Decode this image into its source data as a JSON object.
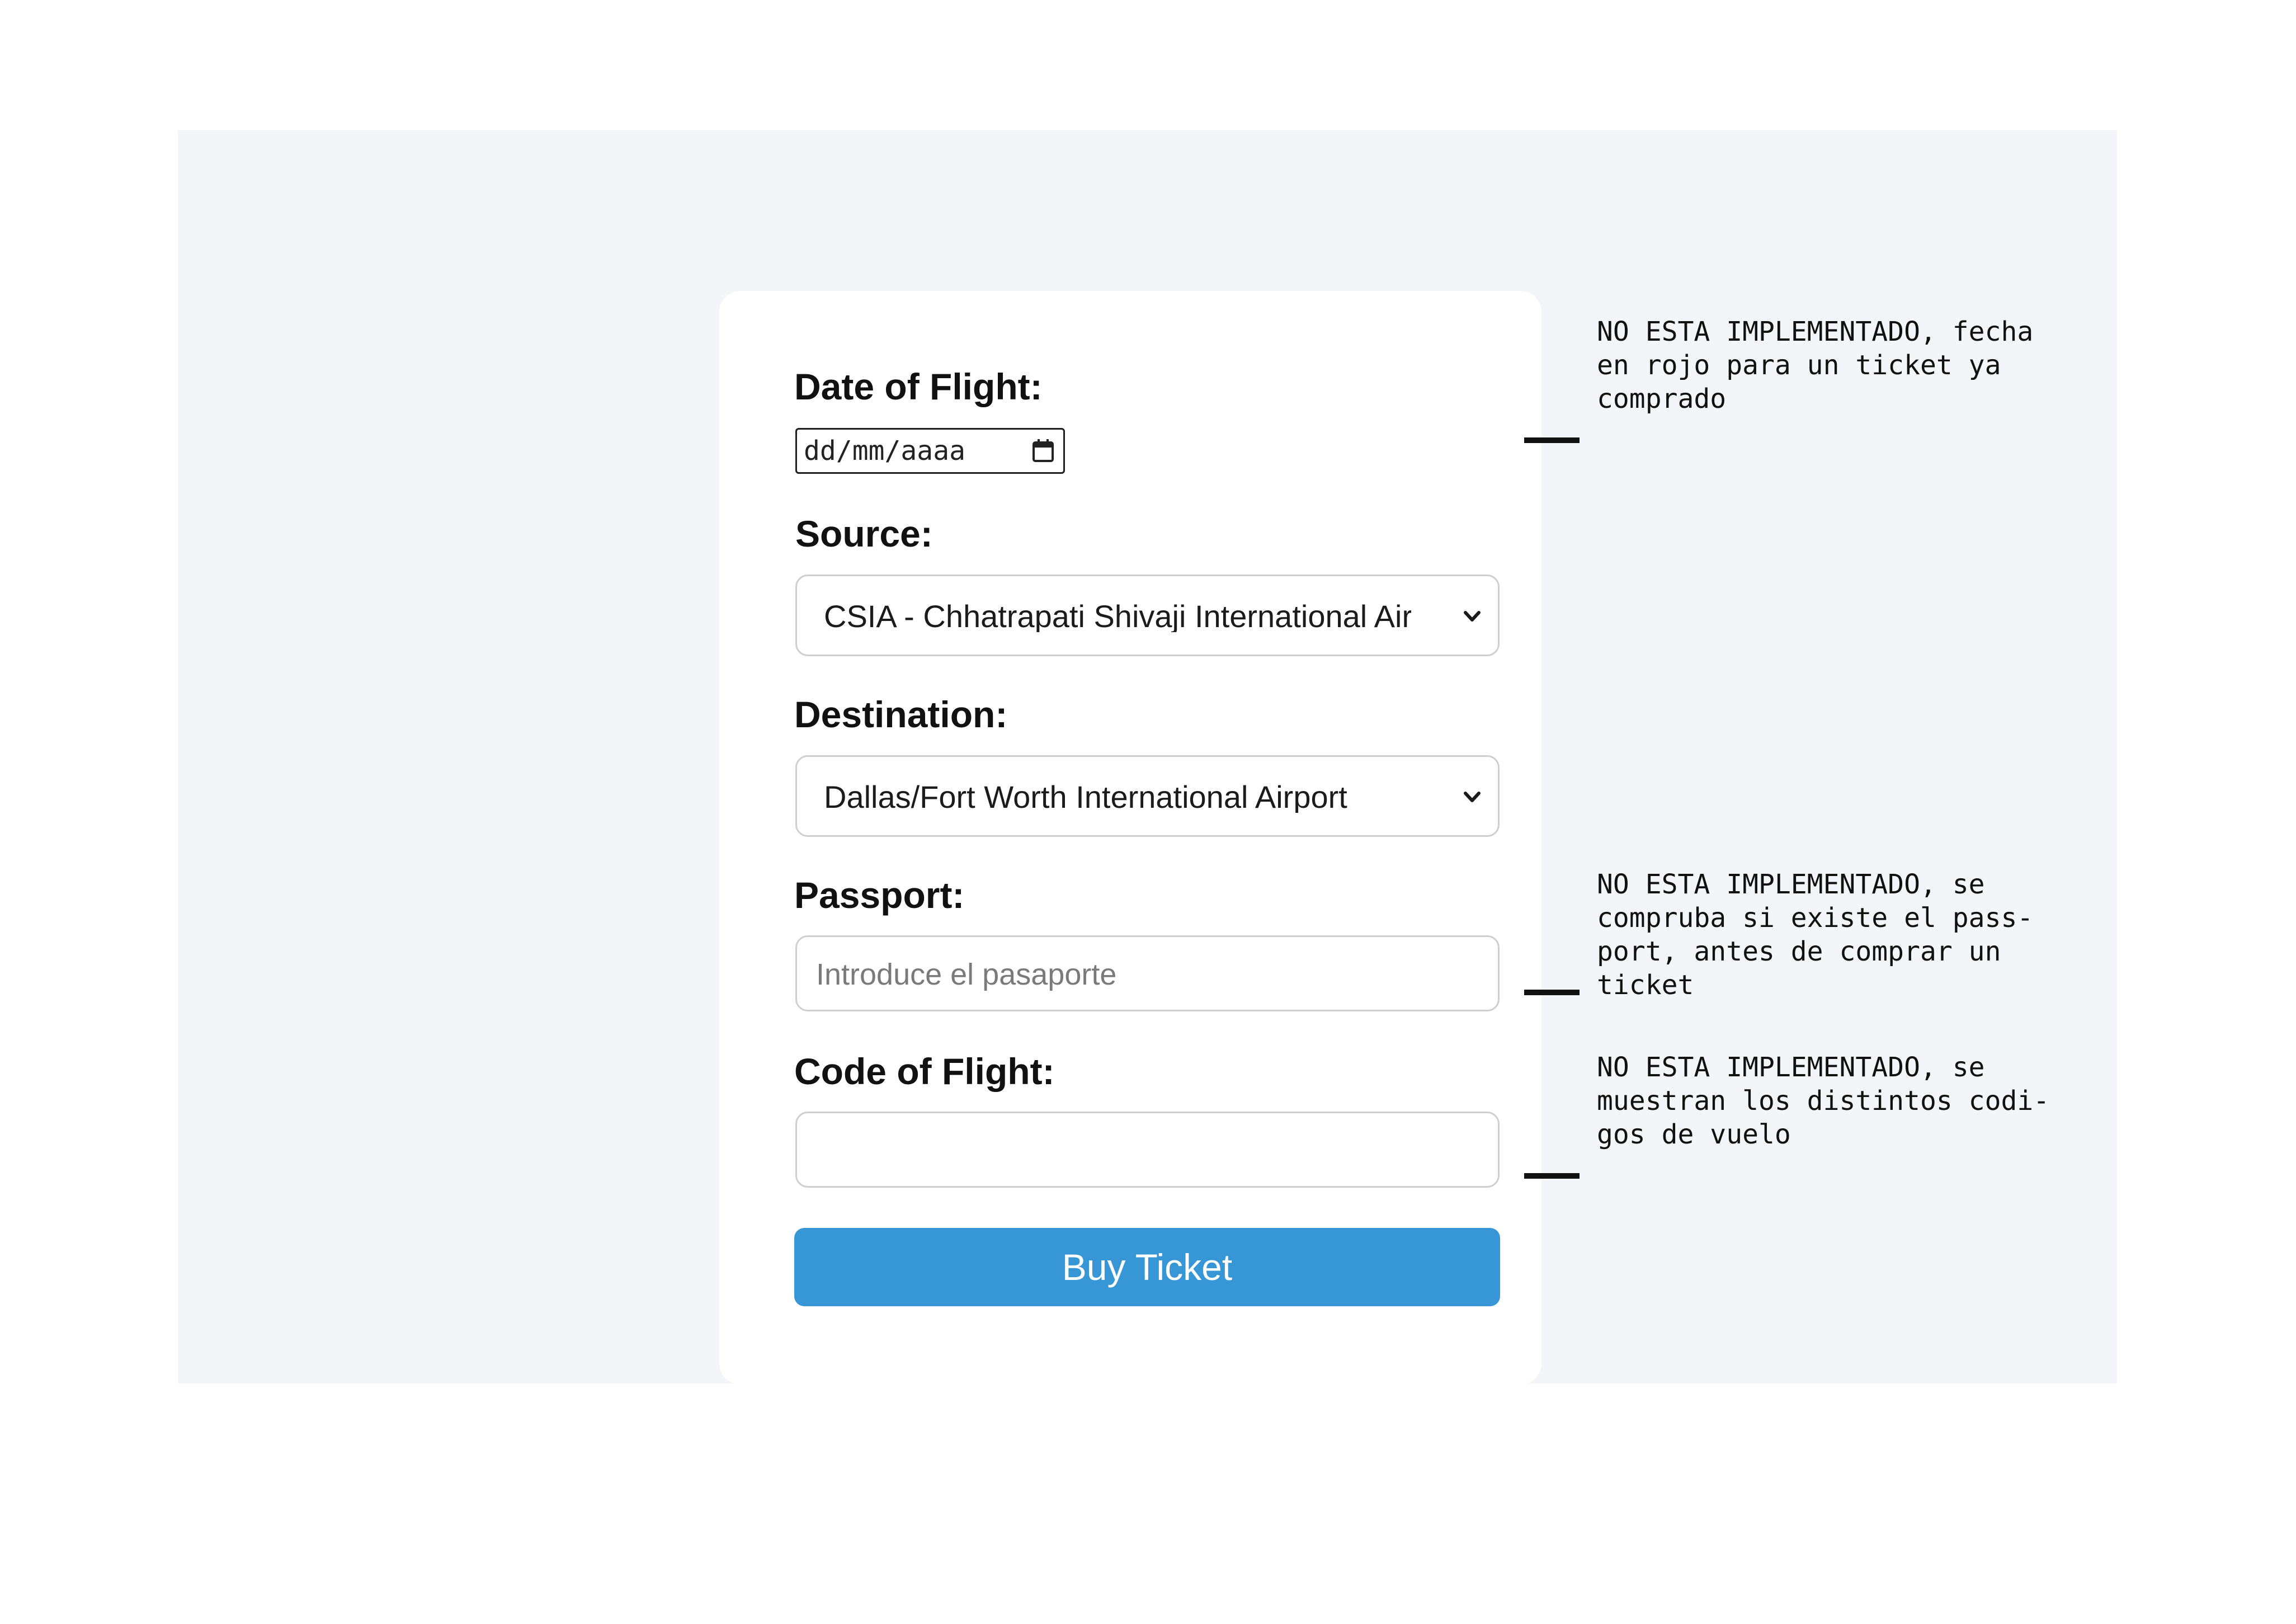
{
  "form": {
    "date_label": "Date of Flight:",
    "date_value": "dd/mm/aaaa",
    "source_label": "Source:",
    "source_value": "CSIA - Chhatrapati Shivaji International Airport",
    "destination_label": "Destination:",
    "destination_value": "Dallas/Fort Worth International Airport",
    "passport_label": "Passport:",
    "passport_placeholder": "Introduce el pasaporte",
    "code_label": "Code of Flight:",
    "code_value": "",
    "buy_button_label": "Buy Ticket"
  },
  "notes": [
    {
      "lines": [
        "NO ESTA IMPLEMENTADO, fecha",
        "en rojo para un ticket ya",
        "comprado"
      ]
    },
    {
      "lines": [
        "NO ESTA IMPLEMENTADO, se",
        "compruba si existe el pass-",
        "port, antes de comprar un",
        "ticket"
      ]
    },
    {
      "lines": [
        "NO ESTA IMPLEMENTADO, se",
        "muestran los distintos codi-",
        "gos de vuelo"
      ]
    }
  ],
  "icons": {
    "date_picker": "calendar-icon",
    "select_arrow": "chevron-down-icon"
  },
  "colors": {
    "page_background": "#f4f5f8",
    "card_background": "#ffffff",
    "button": "#3796d5",
    "button_text": "#ffffff",
    "input_border": "#cfcfcf"
  }
}
